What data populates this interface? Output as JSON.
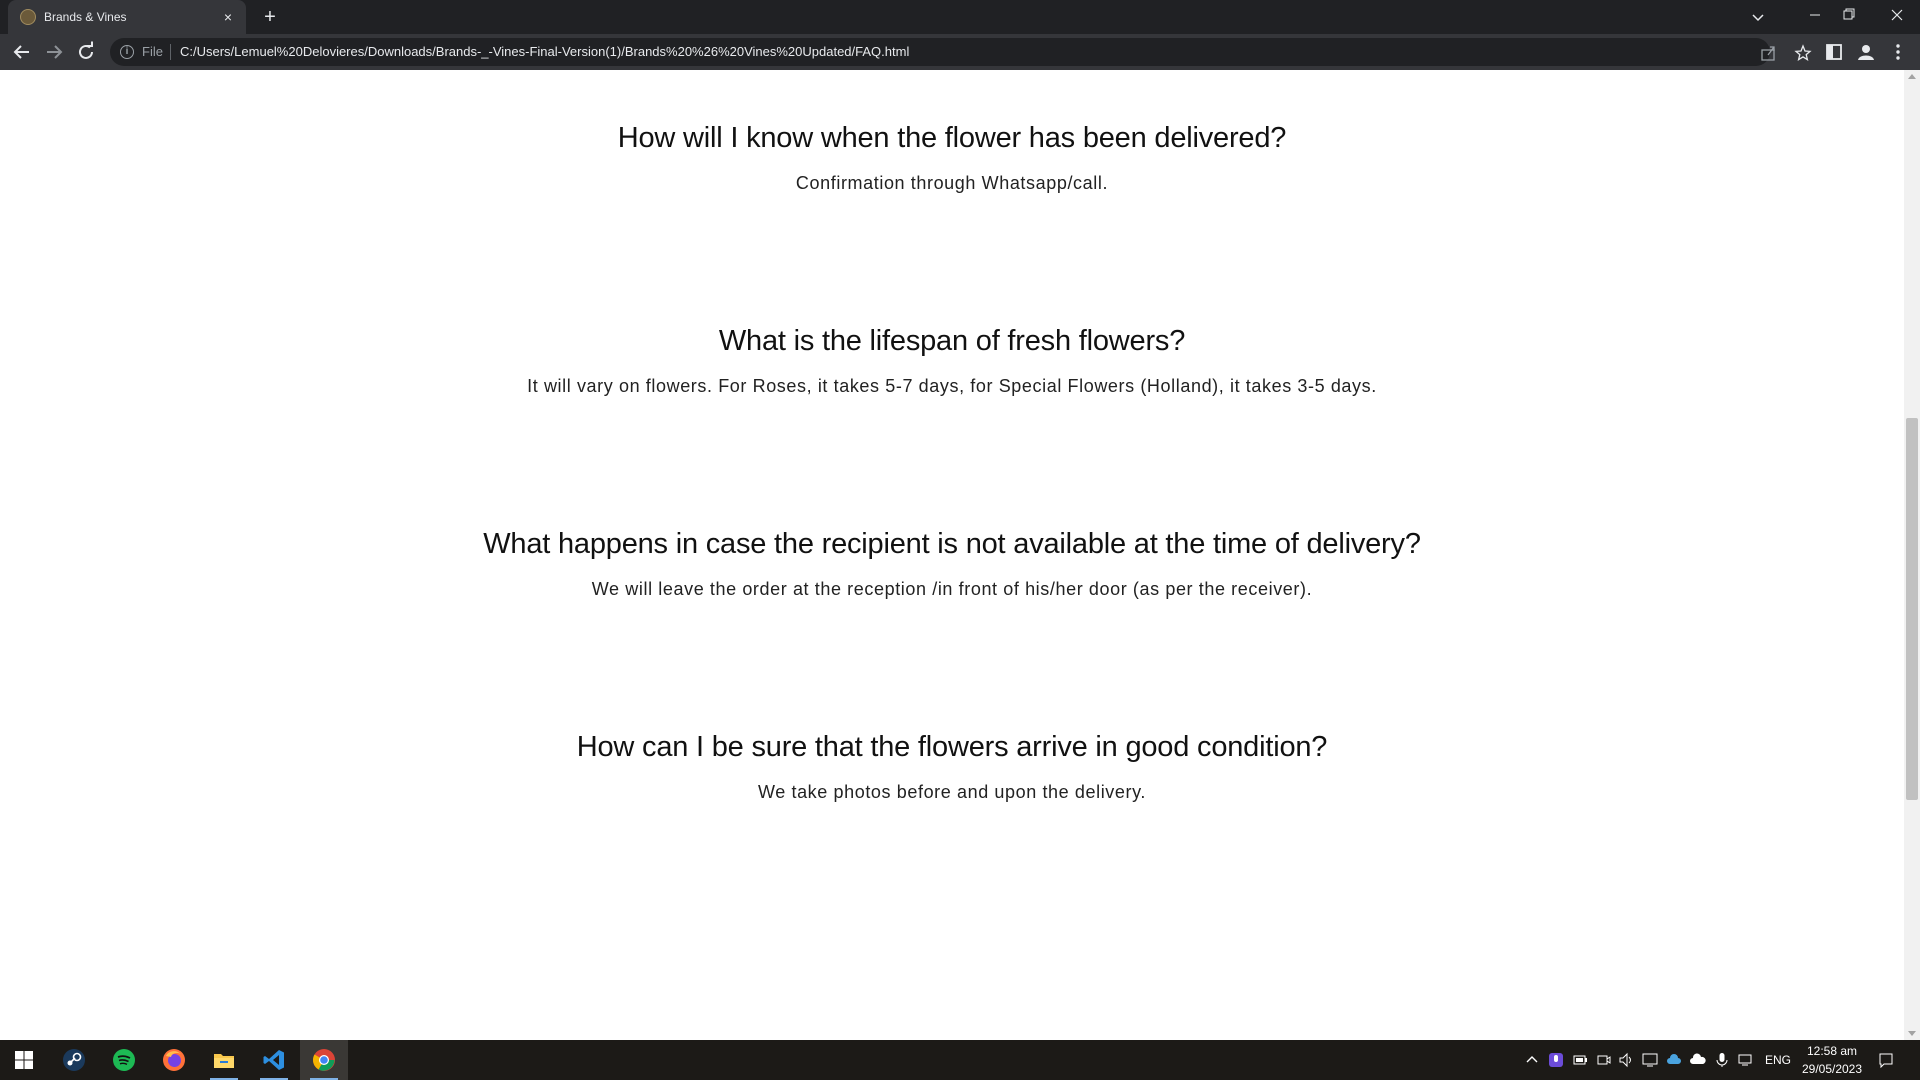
{
  "browser": {
    "tab_title": "Brands & Vines",
    "close_glyph": "×",
    "new_tab_glyph": "+",
    "scheme_label": "File",
    "url": "C:/Users/Lemuel%20Delovieres/Downloads/Brands-_-Vines-Final-Version(1)/Brands%20%26%20Vines%20Updated/FAQ.html"
  },
  "faq": {
    "items": [
      {
        "question": "How will I know when the flower has been delivered?",
        "answer": "Confirmation through Whatsapp/call."
      },
      {
        "question": "What is the lifespan of fresh flowers?",
        "answer": "It will vary on flowers. For Roses, it takes 5-7 days, for Special Flowers (Holland), it takes 3-5 days."
      },
      {
        "question": "What happens in case the recipient is not available at the time of delivery?",
        "answer": "We will leave the order at the reception /in front of his/her door (as per the receiver)."
      },
      {
        "question": "How can I be sure that the flowers arrive in good condition?",
        "answer": "We take photos before and upon the delivery."
      }
    ]
  },
  "taskbar": {
    "apps": [
      "windows-start-icon",
      "steam-icon",
      "spotify-icon",
      "firefox-icon",
      "file-explorer-icon",
      "vscode-icon",
      "chrome-icon"
    ],
    "language": "ENG",
    "time": "12:58 am",
    "date": "29/05/2023"
  },
  "colors": {
    "chrome_dark": "#202124",
    "chrome_toolbar": "#35363a",
    "taskbar": "#1c1a17",
    "heading_text": "#111111",
    "body_text": "#222222"
  }
}
